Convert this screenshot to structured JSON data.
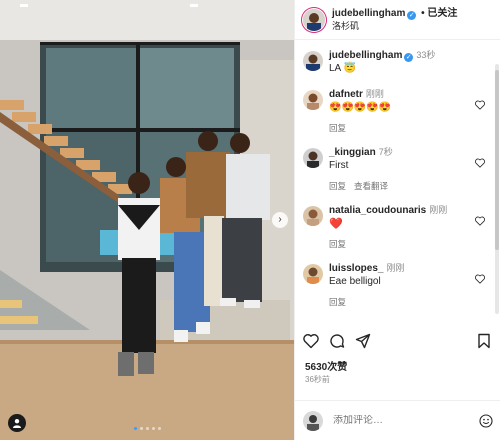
{
  "post": {
    "username": "judebellingham",
    "follow_label": "• 已关注",
    "location": "洛杉矶",
    "caption": "LA 😇",
    "caption_time": "33秒",
    "likes": "5630次赞",
    "posted_ago": "36秒前",
    "add_comment_placeholder": "添加评论…"
  },
  "comments": [
    {
      "user": "dafnetr",
      "time": "刚刚",
      "text": "😍😍😍😍😍",
      "actions": [
        "回复"
      ]
    },
    {
      "user": "_kinggian",
      "time": "7秒",
      "text": "First",
      "actions": [
        "回复",
        "查看翻译"
      ]
    },
    {
      "user": "natalia_coudounaris",
      "time": "刚刚",
      "text": "❤️",
      "actions": [
        "回复"
      ]
    },
    {
      "user": "luisslopes_",
      "time": "刚刚",
      "text": "Eae belligol",
      "actions": [
        "回复"
      ]
    }
  ],
  "colors": {
    "verified": "#3897f0",
    "heart": "#e0245e",
    "carousel_active_dot": "#3a9cff"
  }
}
